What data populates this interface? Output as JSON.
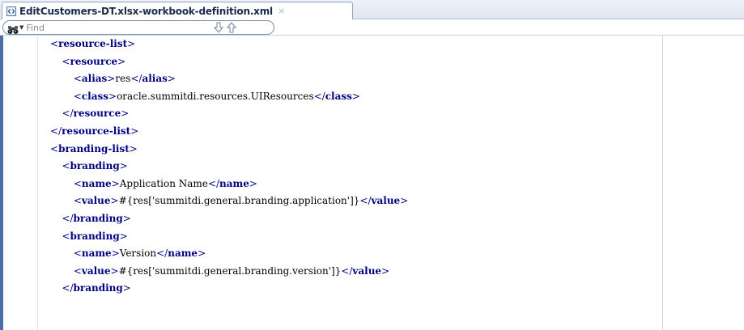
{
  "tab": {
    "title": "EditCustomers-DT.xlsx-workbook-definition.xml",
    "close_label": "×"
  },
  "find": {
    "placeholder": "Find",
    "icon": "binoculars-icon",
    "down_icon": "arrow-down-icon",
    "up_icon": "arrow-up-icon"
  },
  "colors": {
    "tag": "#000080",
    "text": "#000000",
    "edge": "#4a6fa5"
  },
  "code": {
    "lines": [
      {
        "indent": 2,
        "open": "resource-list",
        "text": "",
        "close": ""
      },
      {
        "indent": 3,
        "open": "resource",
        "text": "",
        "close": ""
      },
      {
        "indent": 4,
        "open": "alias",
        "text": "res",
        "close": "alias"
      },
      {
        "indent": 4,
        "open": "class",
        "text": "oracle.summitdi.resources.UIResources",
        "close": "class"
      },
      {
        "indent": 3,
        "open": "",
        "text": "",
        "close": "resource"
      },
      {
        "indent": 2,
        "open": "",
        "text": "",
        "close": "resource-list"
      },
      {
        "indent": 2,
        "open": "branding-list",
        "text": "",
        "close": ""
      },
      {
        "indent": 3,
        "open": "branding",
        "text": "",
        "close": ""
      },
      {
        "indent": 4,
        "open": "name",
        "text": "Application Name",
        "close": "name"
      },
      {
        "indent": 4,
        "open": "value",
        "text": "#{res['summitdi.general.branding.application']}",
        "close": "value"
      },
      {
        "indent": 3,
        "open": "",
        "text": "",
        "close": "branding"
      },
      {
        "indent": 3,
        "open": "branding",
        "text": "",
        "close": ""
      },
      {
        "indent": 4,
        "open": "name",
        "text": "Version",
        "close": "name"
      },
      {
        "indent": 4,
        "open": "value",
        "text": "#{res['summitdi.general.branding.version']}",
        "close": "value"
      },
      {
        "indent": 3,
        "open": "",
        "text": "",
        "close": "branding"
      }
    ]
  }
}
